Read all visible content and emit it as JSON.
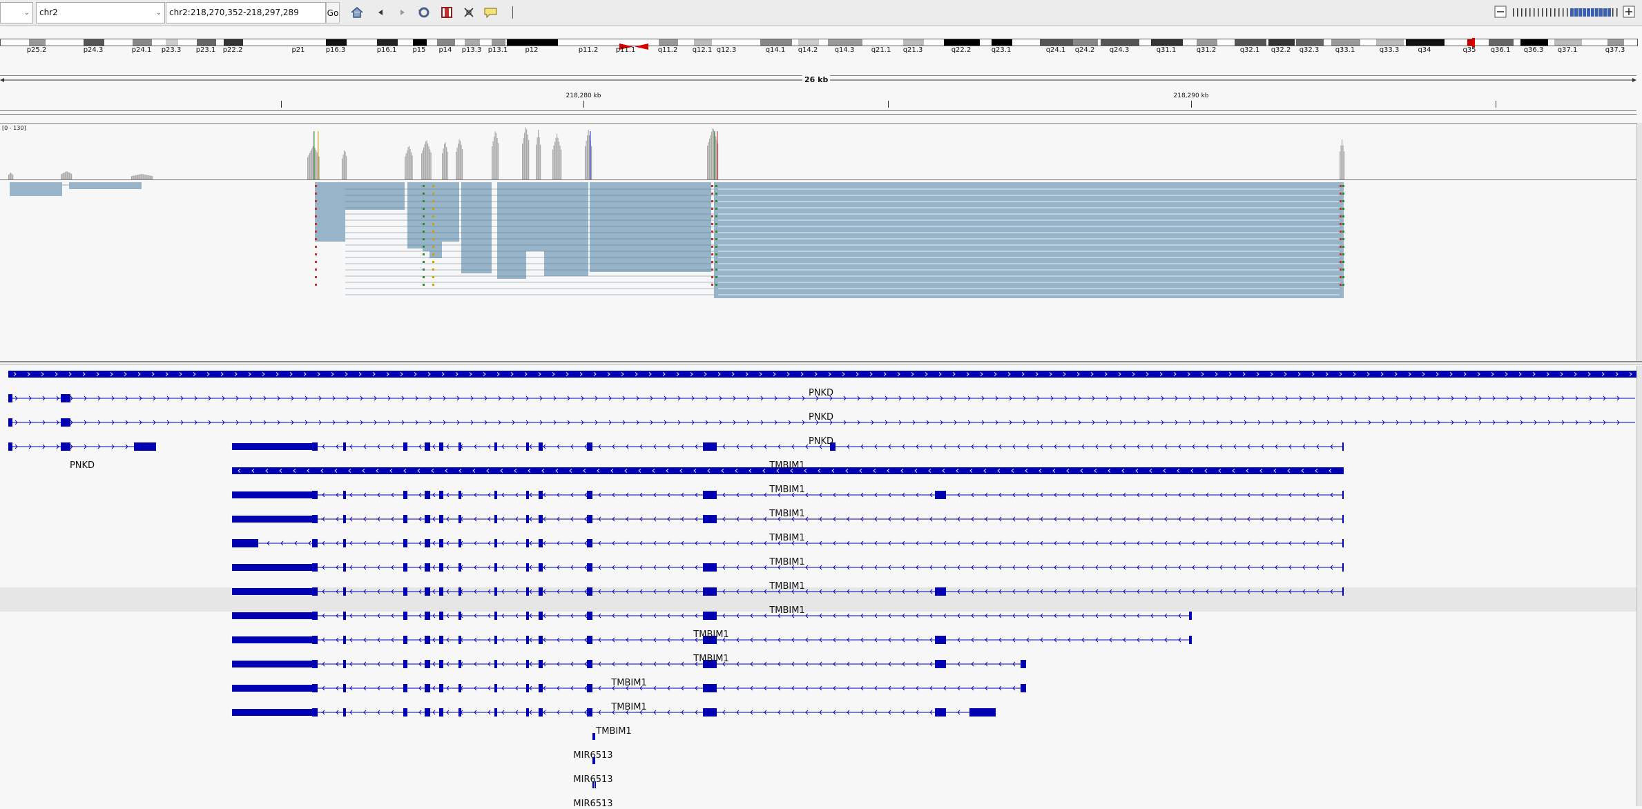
{
  "toolbar": {
    "genome_value": "",
    "chromosome_value": "chr2",
    "locus_value": "chr2:218,270,352-218,297,289",
    "go_label": "Go"
  },
  "ideogram": {
    "bands": [
      "p25.2",
      "p24.3",
      "p24.1",
      "p23.3",
      "p23.1",
      "p22.2",
      "p21",
      "p16.3",
      "p16.1",
      "p15",
      "p14",
      "p13.3",
      "p13.1",
      "p12",
      "p11.2",
      "p11.1",
      "q11.2",
      "q12.1",
      "q12.3",
      "q14.1",
      "q14.2",
      "q14.3",
      "q21.1",
      "q21.3",
      "q22.2",
      "q23.1",
      "q24.1",
      "q24.2",
      "q24.3",
      "q31.1",
      "q31.2",
      "q32.1",
      "q32.2",
      "q32.3",
      "q33.1",
      "q33.3",
      "q34",
      "q35",
      "q36.1",
      "q36.3",
      "q37.1",
      "q37.3"
    ]
  },
  "ruler": {
    "span_label": "26 kb",
    "tick_labels": [
      "218,280 kb",
      "218,290 kb"
    ]
  },
  "coverage": {
    "range_label": "[0 - 130]"
  },
  "genes": {
    "labels": [
      "PNKD",
      "PNKD",
      "PNKD",
      "PNKD",
      "TMBIM1",
      "TMBIM1",
      "TMBIM1",
      "TMBIM1",
      "TMBIM1",
      "TMBIM1",
      "TMBIM1",
      "TMBIM1",
      "TMBIM1",
      "TMBIM1",
      "TMBIM1",
      "TMBIM1",
      "MIR6513",
      "MIR6513",
      "MIR6513"
    ]
  },
  "colors": {
    "gene": "#0000b2",
    "read": "#97b4c8",
    "coverage": "#a8a8a8",
    "centromere": "#d40000",
    "highlight_row": "#e6e6e6"
  }
}
